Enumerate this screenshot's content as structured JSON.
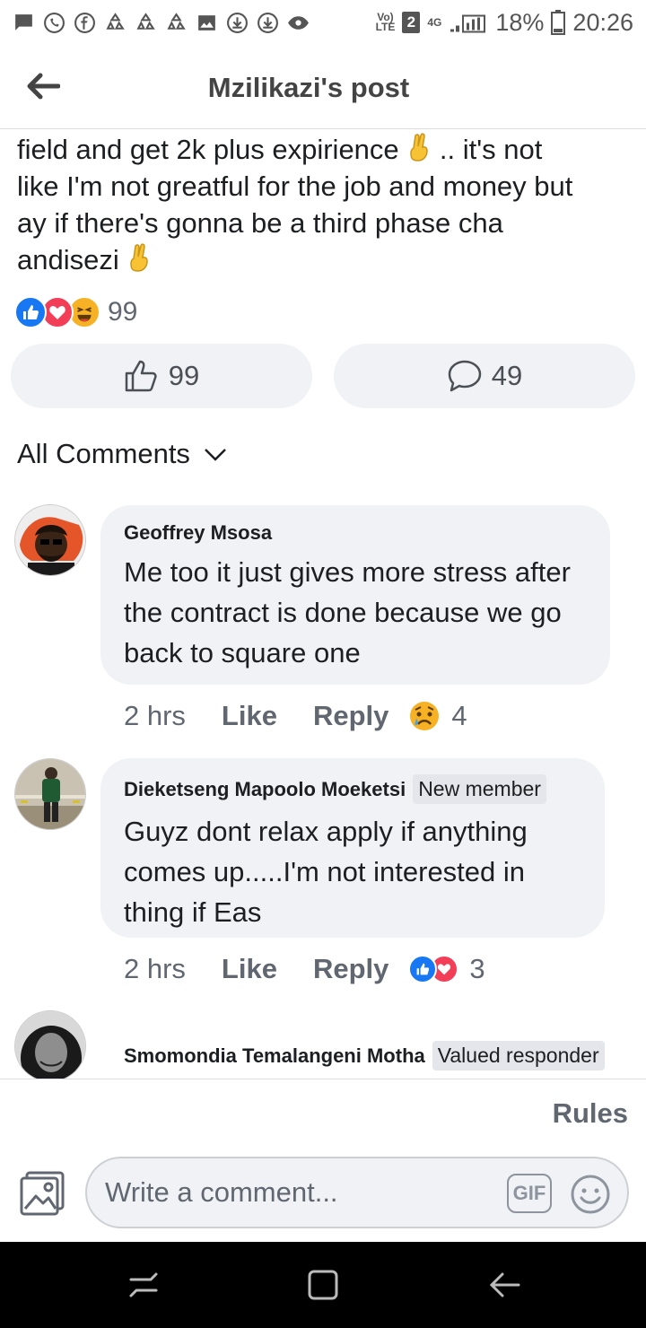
{
  "status_bar": {
    "volte": "Vo)\nLTE",
    "sim": "2",
    "network": "4G",
    "battery": "18%",
    "time": "20:26"
  },
  "header": {
    "title": "Mzilikazi's post"
  },
  "post": {
    "line1": "field and get 2k plus expirience",
    "line1_after": ".. it's not",
    "line2": "like I'm not greatful for the job and money but",
    "line3": "ay if there's gonna be a third phase cha",
    "line4": "andisezi",
    "reaction_count": "99",
    "like_count": "99",
    "comment_count": "49"
  },
  "comments_section": {
    "title": "All Comments"
  },
  "comments": [
    {
      "author": "Geoffrey Msosa",
      "badge": "",
      "text": "Me too it just gives more stress after the contract is done because we go back to square one",
      "time": "2 hrs",
      "like": "Like",
      "reply": "Reply",
      "reaction_count": "4"
    },
    {
      "author": "Dieketseng Mapoolo Moeketsi",
      "badge": "New member",
      "text": "Guyz dont relax apply if anything comes up.....I'm not interested in thing if Eas",
      "time": "2 hrs",
      "like": "Like",
      "reply": "Reply",
      "reaction_count": "3"
    },
    {
      "author": "Smomondia Temalangeni Motha",
      "badge": "Valued responder"
    }
  ],
  "composer": {
    "rules": "Rules",
    "placeholder": "Write a comment...",
    "gif": "GIF"
  },
  "colors": {
    "like_blue": "#1877f2",
    "love_red": "#f33e58",
    "haha_yellow": "#f7b125",
    "bubble_bg": "#f0f2f5",
    "secondary_text": "#606770"
  }
}
